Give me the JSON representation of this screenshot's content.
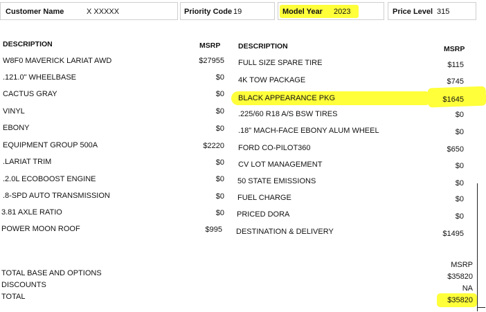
{
  "header": {
    "customer_name_label": "Customer Name",
    "customer_name_value": "X XXXXX",
    "priority_code_label": "Priority Code",
    "priority_code_value": "19",
    "model_year_label": "Model Year",
    "model_year_value": "2023",
    "price_level_label": "Price Level",
    "price_level_value": "315"
  },
  "columns": {
    "left_description": "DESCRIPTION",
    "left_msrp": "MSRP",
    "right_description": "DESCRIPTION",
    "right_msrp": "MSRP"
  },
  "left_items": [
    {
      "desc": "W8F0 MAVERICK LARIAT AWD",
      "msrp": "$27955"
    },
    {
      "desc": ".121.0\" WHEELBASE",
      "msrp": "$0"
    },
    {
      "desc": "CACTUS GRAY",
      "msrp": "$0"
    },
    {
      "desc": "VINYL",
      "msrp": "$0"
    },
    {
      "desc": "EBONY",
      "msrp": "$0"
    },
    {
      "desc": "EQUIPMENT GROUP 500A",
      "msrp": "$2220"
    },
    {
      "desc": ".LARIAT TRIM",
      "msrp": "$0"
    },
    {
      "desc": ".2.0L ECOBOOST ENGINE",
      "msrp": "$0"
    },
    {
      "desc": ".8-SPD AUTO TRANSMISSION",
      "msrp": "$0"
    },
    {
      "desc": "3.81 AXLE RATIO",
      "msrp": "$0"
    },
    {
      "desc": "POWER MOON ROOF",
      "msrp": "$995"
    }
  ],
  "right_items": [
    {
      "desc": "FULL SIZE SPARE TIRE",
      "msrp": "$115"
    },
    {
      "desc": "4K TOW PACKAGE",
      "msrp": "$745"
    },
    {
      "desc": "BLACK APPEARANCE PKG",
      "msrp": "$1645"
    },
    {
      "desc": ".225/60 R18 A/S BSW TIRES",
      "msrp": "$0"
    },
    {
      "desc": ".18\" MACH-FACE EBONY ALUM WHEEL",
      "msrp": "$0"
    },
    {
      "desc": "FORD CO-PILOT360",
      "msrp": "$650"
    },
    {
      "desc": "CV LOT MANAGEMENT",
      "msrp": "$0"
    },
    {
      "desc": "50 STATE EMISSIONS",
      "msrp": "$0"
    },
    {
      "desc": "FUEL CHARGE",
      "msrp": "$0"
    },
    {
      "desc": "PRICED DORA",
      "msrp": "$0"
    },
    {
      "desc": "DESTINATION & DELIVERY",
      "msrp": "$1495"
    }
  ],
  "totals": {
    "msrp_label": "MSRP",
    "base_label": "TOTAL BASE AND OPTIONS",
    "base_value": "$35820",
    "discounts_label": "DISCOUNTS",
    "discounts_value": "NA",
    "total_label": "TOTAL",
    "total_value": "$35820"
  },
  "colors": {
    "highlight": "#ffff3a"
  }
}
